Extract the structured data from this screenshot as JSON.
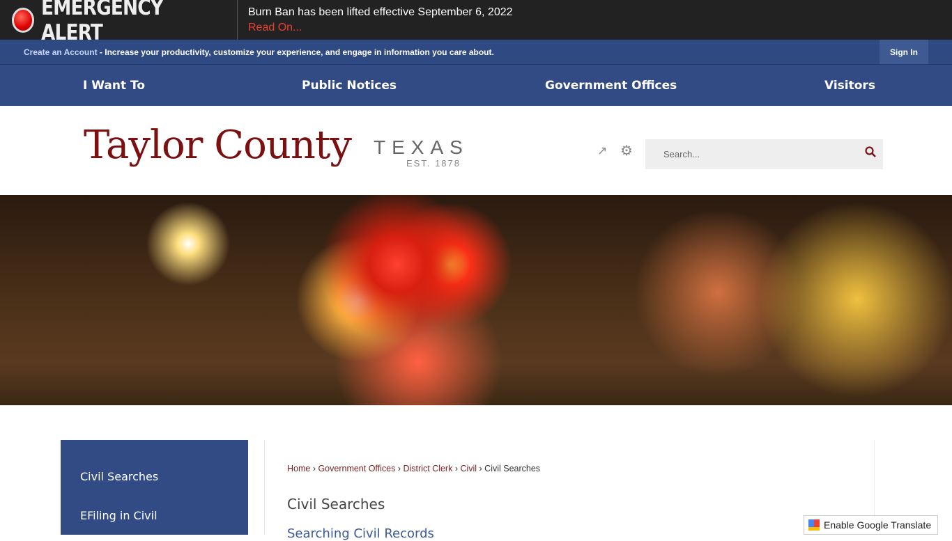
{
  "alert": {
    "title": "EMERGENCY ALERT",
    "message": "Burn Ban has been lifted effective September 6, 2022",
    "link": "Read On..."
  },
  "account": {
    "link": "Create an Account",
    "text": " - Increase your productivity, customize your experience, and engage in information you care about.",
    "sign_in": "Sign In"
  },
  "nav": [
    "I Want To",
    "Public Notices",
    "Government Offices",
    "Visitors"
  ],
  "logo": {
    "name": "Taylor County",
    "state": "TEXAS",
    "est": "EST. 1878"
  },
  "search": {
    "placeholder": "Search..."
  },
  "sidebar": [
    "Civil Searches",
    "EFiling in Civil"
  ],
  "breadcrumb": [
    "Home",
    "Government Offices",
    "District Clerk",
    "Civil",
    "Civil Searches"
  ],
  "page": {
    "title": "Civil Searches",
    "subtitle": "Searching Civil Records"
  },
  "translate": "Enable Google Translate",
  "colors": {
    "nav": "#334b84",
    "brand": "#7a1010",
    "alert": "#e8402f"
  }
}
